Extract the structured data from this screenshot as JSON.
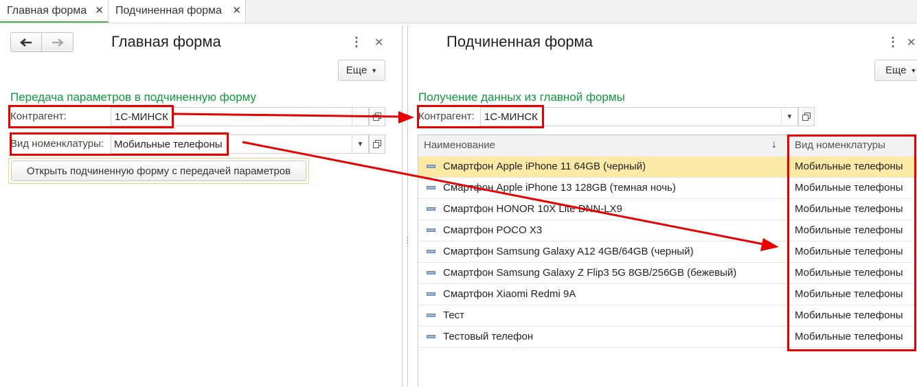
{
  "tabs": [
    {
      "label": "Главная форма",
      "close": "✕"
    },
    {
      "label": "Подчиненная форма",
      "close": "✕"
    }
  ],
  "left": {
    "title": "Главная форма",
    "more_label": "Еще",
    "group_title": "Передача параметров в подчиненную форму",
    "counterparty_label": "Контрагент:",
    "counterparty_value": "1С-МИНСК",
    "kind_label": "Вид номенклатуры:",
    "kind_value": "Мобильные телефоны",
    "open_button_label": "Открыть подчиненную форму с передачей параметров"
  },
  "right": {
    "title": "Подчиненная форма",
    "more_label": "Еще",
    "group_title": "Получение данных из главной формы",
    "counterparty_label": "Контрагент:",
    "counterparty_value": "1С-МИНСК",
    "table": {
      "columns": [
        "Наименование",
        "Вид номенклатуры"
      ],
      "sort_indicator": "↓",
      "rows": [
        {
          "name": "Смартфон Apple iPhone 11 64GB (черный)",
          "kind": "Мобильные телефоны"
        },
        {
          "name": "Смартфон Apple iPhone 13 128GB (темная ночь)",
          "kind": "Мобильные телефоны"
        },
        {
          "name": "Смартфон HONOR 10X Lite DNN-LX9",
          "kind": "Мобильные телефоны"
        },
        {
          "name": "Смартфон POCO X3",
          "kind": "Мобильные телефоны"
        },
        {
          "name": "Смартфон Samsung Galaxy A12 4GB/64GB (черный)",
          "kind": "Мобильные телефоны"
        },
        {
          "name": "Смартфон Samsung Galaxy Z Flip3 5G 8GB/256GB (бежевый)",
          "kind": "Мобильные телефоны"
        },
        {
          "name": "Смартфон Xiaomi Redmi 9A",
          "kind": "Мобильные телефоны"
        },
        {
          "name": "Тест",
          "kind": "Мобильные телефоны"
        },
        {
          "name": "Тестовый телефон",
          "kind": "Мобильные телефоны"
        }
      ]
    }
  },
  "colors": {
    "accent_green": "#0e9a3a",
    "annotation_red": "#e60000",
    "selected_row": "#fde9a6"
  }
}
